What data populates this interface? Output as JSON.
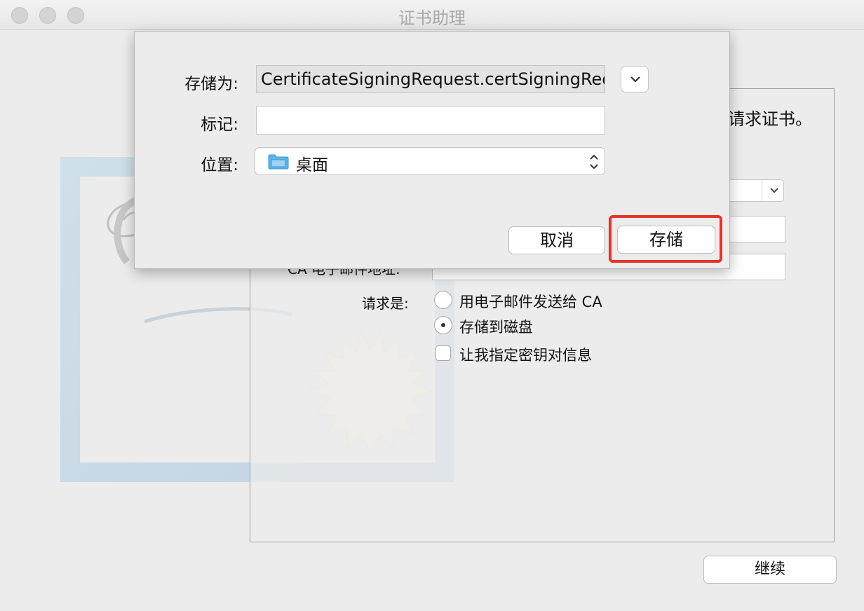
{
  "window": {
    "title": "证书助理"
  },
  "background_panel": {
    "heading_partial": "请求证书。",
    "ca_email_label_partial": "CA 电子邮件地址:",
    "request_label": "请求是:",
    "options": [
      {
        "label": "用电子邮件发送给 CA",
        "selected": false
      },
      {
        "label": "存储到磁盘",
        "selected": true
      }
    ],
    "checkbox": {
      "label": "让我指定密钥对信息",
      "checked": false
    },
    "continue_button": "继续"
  },
  "save_sheet": {
    "save_as_label": "存储为:",
    "save_as_value": "CertificateSigningRequest.certSigningRequest",
    "tags_label": "标记:",
    "tags_value": "",
    "location_label": "位置:",
    "location_value": "桌面",
    "cancel_button": "取消",
    "save_button": "存储",
    "expand_icon": "chevron-down-icon",
    "location_icon": "folder-icon"
  },
  "colors": {
    "highlight": "#e8322a",
    "folder": "#5fb4ea"
  }
}
